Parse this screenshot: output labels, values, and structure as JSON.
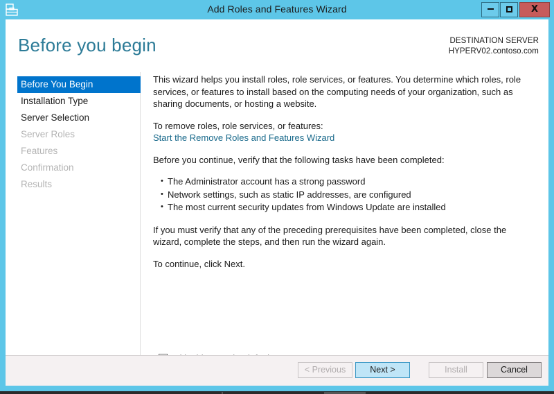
{
  "window": {
    "title": "Add Roles and Features Wizard",
    "icon": "server-manager-icon",
    "controls": {
      "minimize": "minimize-icon",
      "maximize": "maximize-icon",
      "close_label": "X"
    },
    "frame_color": "#5dc6e8",
    "close_color": "#c75b5b"
  },
  "header": {
    "page_title": "Before you begin",
    "page_title_color": "#2c7b97",
    "destination_label": "DESTINATION SERVER",
    "destination_server": "HYPERV02.contoso.com"
  },
  "sidebar": {
    "items": [
      {
        "label": "Before You Begin",
        "state": "selected"
      },
      {
        "label": "Installation Type",
        "state": "enabled"
      },
      {
        "label": "Server Selection",
        "state": "enabled"
      },
      {
        "label": "Server Roles",
        "state": "disabled"
      },
      {
        "label": "Features",
        "state": "disabled"
      },
      {
        "label": "Confirmation",
        "state": "disabled"
      },
      {
        "label": "Results",
        "state": "disabled"
      }
    ],
    "selected_color": "#0074cc"
  },
  "content": {
    "intro": "This wizard helps you install roles, role services, or features. You determine which roles, role services, or features to install based on the computing needs of your organization, such as sharing documents, or hosting a website.",
    "remove_prompt": "To remove roles, role services, or features:",
    "remove_link": "Start the Remove Roles and Features Wizard",
    "remove_link_color": "#17688a",
    "verify_prompt": "Before you continue, verify that the following tasks have been completed:",
    "tasks": [
      "The Administrator account has a strong password",
      "Network settings, such as static IP addresses, are configured",
      "The most current security updates from Windows Update are installed"
    ],
    "prerequisites_note": "If you must verify that any of the preceding prerequisites have been completed, close the wizard, complete the steps, and then run the wizard again.",
    "continue_note": "To continue, click Next."
  },
  "skip_option": {
    "label": "Skip this page by default",
    "checked": false
  },
  "footer": {
    "buttons": [
      {
        "label": "< Previous",
        "state": "disabled"
      },
      {
        "label": "Next >",
        "state": "default"
      },
      {
        "label": "Install",
        "state": "disabled"
      },
      {
        "label": "Cancel",
        "state": "enabled"
      }
    ],
    "default_button_color": "#bfe5f7"
  }
}
